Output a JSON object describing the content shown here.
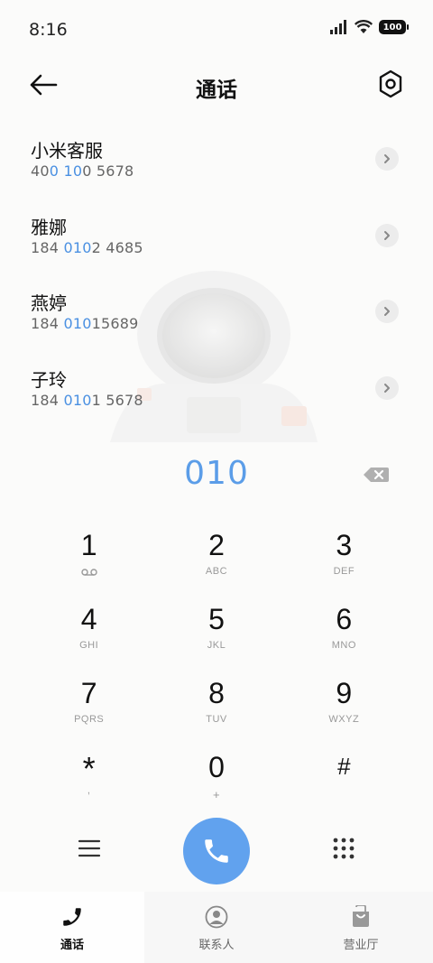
{
  "status_bar": {
    "time": "8:16",
    "battery_level": "100"
  },
  "header": {
    "title": "通话",
    "icons": {
      "back": "arrow-left-icon",
      "settings": "settings-hexagon-icon"
    }
  },
  "contacts": [
    {
      "name": "小米客服",
      "number_parts": [
        "40",
        "0",
        " ",
        "10",
        "0 5678"
      ]
    },
    {
      "name": "雅娜",
      "number_parts": [
        "184 ",
        "010",
        "2 4685"
      ]
    },
    {
      "name": "燕婷",
      "number_parts": [
        "184 ",
        "010",
        "15689"
      ]
    },
    {
      "name": "子玲",
      "number_parts": [
        "184 ",
        "010",
        "1 5678"
      ]
    }
  ],
  "dialer": {
    "dialed_number": "010",
    "keys": [
      {
        "digit": "1",
        "letters": ""
      },
      {
        "digit": "2",
        "letters": "ABC"
      },
      {
        "digit": "3",
        "letters": "DEF"
      },
      {
        "digit": "4",
        "letters": "GHI"
      },
      {
        "digit": "5",
        "letters": "JKL"
      },
      {
        "digit": "6",
        "letters": "MNO"
      },
      {
        "digit": "7",
        "letters": "PQRS"
      },
      {
        "digit": "8",
        "letters": "TUV"
      },
      {
        "digit": "9",
        "letters": "WXYZ"
      },
      {
        "digit": "*",
        "letters": ","
      },
      {
        "digit": "0",
        "letters": "+"
      },
      {
        "digit": "#",
        "letters": ""
      }
    ]
  },
  "tabs": [
    {
      "label": "通话",
      "icon": "phone-icon",
      "active": true
    },
    {
      "label": "联系人",
      "icon": "person-icon",
      "active": false
    },
    {
      "label": "营业厅",
      "icon": "shopping-bag-icon",
      "active": false
    }
  ],
  "colors": {
    "accent": "#61a2ee",
    "highlight": "#4a90e2",
    "background": "#fbfbfa"
  }
}
